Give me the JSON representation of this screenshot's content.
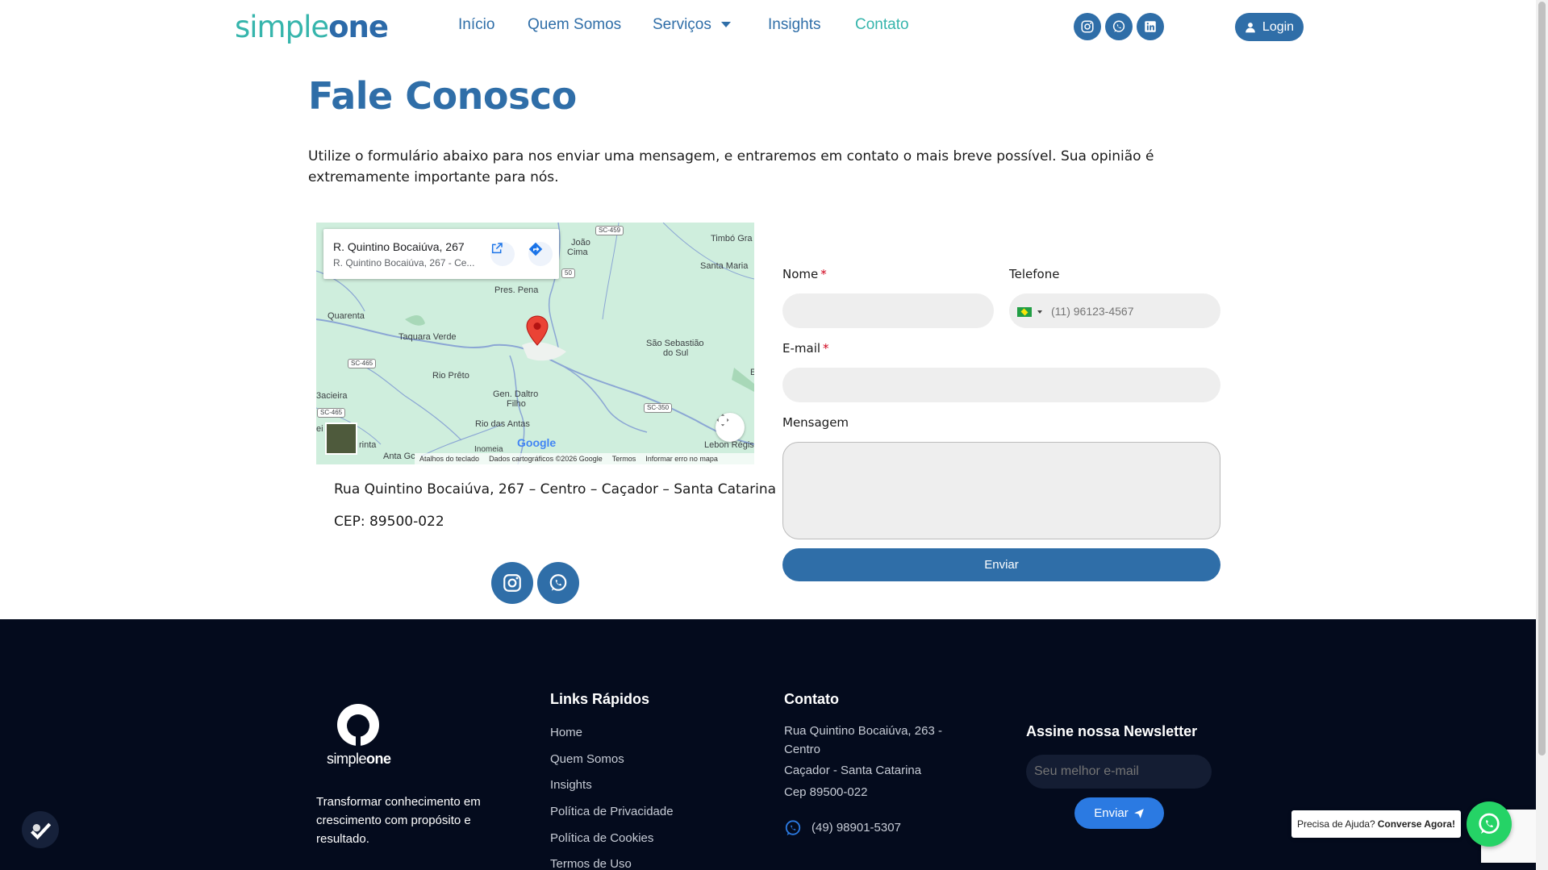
{
  "header": {
    "logo_part1": "simple",
    "logo_part2": "one",
    "nav": [
      {
        "label": "Início"
      },
      {
        "label": "Quem Somos"
      },
      {
        "label": "Serviços"
      },
      {
        "label": "Insights"
      },
      {
        "label": "Contato"
      }
    ],
    "login_label": "Login",
    "social_icons": [
      "instagram-icon",
      "whatsapp-icon",
      "linkedin-icon"
    ]
  },
  "main": {
    "title": "Fale Conosco",
    "intro": "Utilize o formulário abaixo para nos enviar uma mensagem, e entraremos em contato o mais breve possível. Sua opinião é extremamente importante para nós.",
    "address_line": "Rua Quintino Bocaiúva, 267 – Centro – Caçador – Santa Catarina",
    "cep_line": "CEP: 89500-022"
  },
  "map": {
    "card_title": "R. Quintino Bocaiúva, 267",
    "card_subtitle": "R. Quintino Bocaiúva, 267 - Ce...",
    "labels": {
      "joao": "João",
      "cima": "Cima",
      "timbo": "Timbó Gra",
      "santa_maria": "Santa Maria",
      "pres_pena": "Pres. Pena",
      "quarenta": "Quarenta",
      "taquara": "Taquara Verde",
      "sao_sebastiao": "São Sebastião",
      "do_sul": "do Sul",
      "rio_preto": "Rio Prêto",
      "bacieira": "3acieira",
      "gen_daltro": "Gen. Daltro",
      "filho": "Filho",
      "rio_das_antas": "Rio das Antas",
      "inomeia": "Inomeia",
      "lebon": "Lebon Régis",
      "anta_gorda": "Anta Gc",
      "rinta": "rinta",
      "e_edge": "E",
      "ei_edge": "ei"
    },
    "roads": {
      "sc459": "SC-459",
      "sc350a": "50",
      "sc465a": "SC-465",
      "sc465b": "SC-465",
      "sc350b": "SC-350"
    },
    "google": "Google",
    "footer_keyboard": "Atalhos do teclado",
    "footer_data": "Dados cartográficos ©2026 Google",
    "footer_terms": "Termos",
    "footer_report": "Informar erro no mapa"
  },
  "form": {
    "name_label": "Nome",
    "phone_label": "Telefone",
    "phone_placeholder": "(11) 96123-4567",
    "email_label": "E-mail",
    "message_label": "Mensagem",
    "required_mark": "*",
    "submit_label": "Enviar"
  },
  "footer": {
    "logo_text_light": "simple",
    "logo_text_bold": "one",
    "tagline": "Transformar conhecimento em crescimento com propósito e resultado.",
    "links_title": "Links Rápidos",
    "links": [
      "Home",
      "Quem Somos",
      "Insights",
      "Política de Privacidade",
      "Política de Cookies",
      "Termos de Uso"
    ],
    "contact_title": "Contato",
    "contact_address": "Rua Quintino Bocaiúva, 263 - Centro",
    "contact_city": "Caçador - Santa Catarina",
    "contact_cep": "Cep 89500-022",
    "contact_phone": "(49) 98901-5307",
    "newsletter_title": "Assine nossa Newsletter",
    "newsletter_placeholder": "Seu melhor e-mail",
    "newsletter_button": "Enviar"
  },
  "widgets": {
    "help_text": "Precisa de Ajuda?",
    "help_bold": "Converse Agora!"
  },
  "colors": {
    "brand_blue": "#2f6ea8",
    "brand_teal": "#36b5ac",
    "footer_bg": "#040b1d",
    "whatsapp_green": "#25d366"
  }
}
